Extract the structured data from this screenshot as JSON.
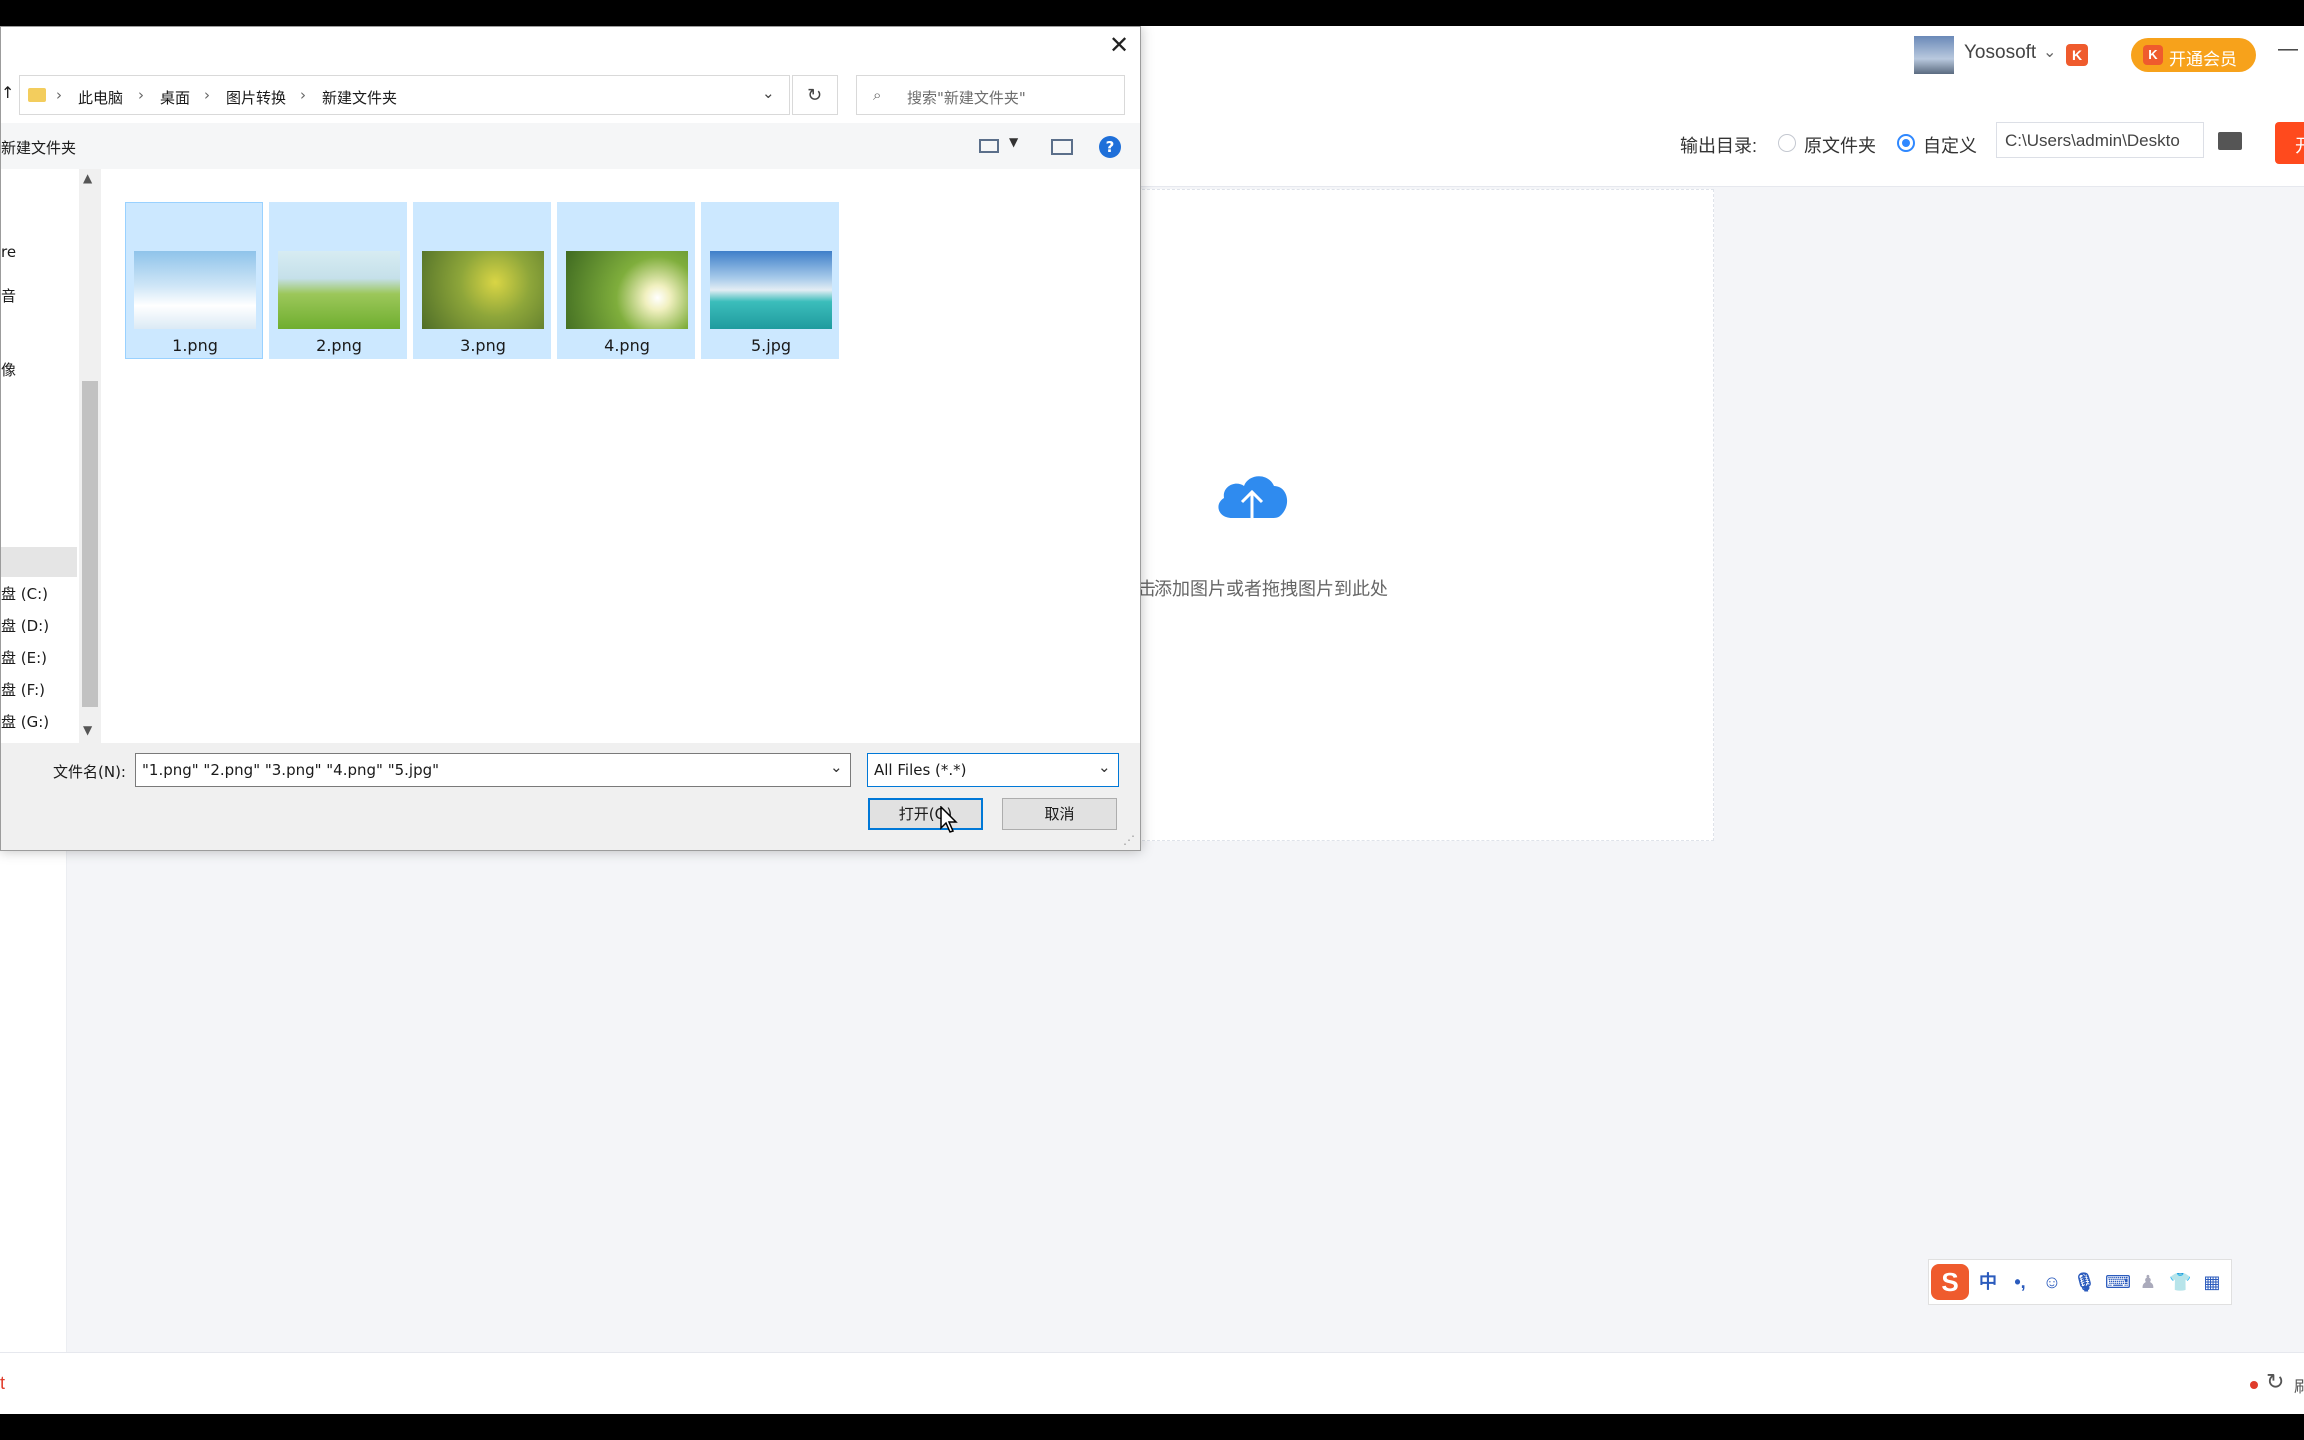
{
  "app": {
    "username": "Yososoft",
    "vip_label": "开通会员",
    "output_label": "输出目录:",
    "opt_original": "原文件夹",
    "opt_custom": "自定义",
    "output_path": "C:\\Users\\admin\\Deskto",
    "drop_hint": "添加图片或者拖拽图片到此处",
    "drop_hint_prefix": "击",
    "minimize_icon": "—",
    "start_btn_fragment": "开",
    "status_left": "t",
    "status_right": "刷"
  },
  "dialog": {
    "breadcrumb": [
      "此电脑",
      "桌面",
      "图片转换",
      "新建文件夹"
    ],
    "search_placeholder": "搜索\"新建文件夹\"",
    "new_folder_label": "新建文件夹",
    "nav_items": [
      {
        "label": "re"
      },
      {
        "label": "音"
      },
      {
        "label": "像"
      },
      {
        "label": "盘 (C:)"
      },
      {
        "label": "盘 (D:)"
      },
      {
        "label": "盘 (E:)"
      },
      {
        "label": "盘 (F:)"
      },
      {
        "label": "盘 (G:)"
      }
    ],
    "files": [
      {
        "name": "1.png",
        "thumb": "sky-clouds"
      },
      {
        "name": "2.png",
        "thumb": "green-meadow"
      },
      {
        "name": "3.png",
        "thumb": "rapeseed-flowers"
      },
      {
        "name": "4.png",
        "thumb": "daisy-field"
      },
      {
        "name": "5.jpg",
        "thumb": "sea-pier"
      }
    ],
    "filename_label": "文件名(N):",
    "filename_value": "\"1.png\" \"2.png\" \"3.png\" \"4.png\" \"5.jpg\"",
    "filetype_value": "All Files (*.*)",
    "open_label": "打开(O)",
    "cancel_label": "取消"
  },
  "ime": {
    "mode": "中"
  },
  "colors": {
    "accent": "#2f88ff",
    "vip_orange": "#f7a21b",
    "start_red": "#ff4a1d",
    "selection": "#cce8ff"
  }
}
